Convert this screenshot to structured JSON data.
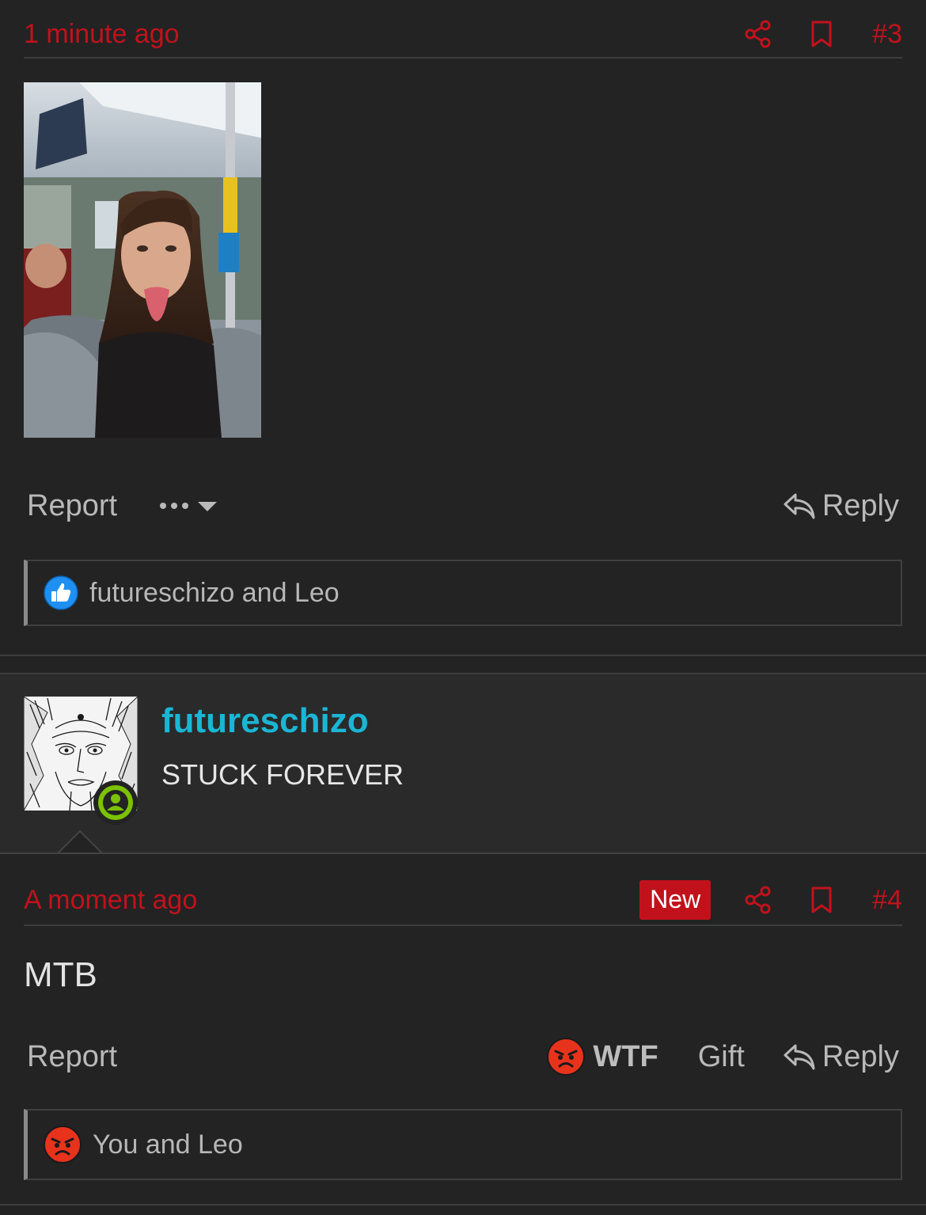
{
  "post3": {
    "time": "1 minute ago",
    "number": "#3",
    "image_alt": "Photo of a girl sticking out her tongue on a bus",
    "actions": {
      "report": "Report",
      "reply": "Reply"
    },
    "reactions_text": "futureschizo and Leo"
  },
  "author4": {
    "username": "futureschizo",
    "user_title": "STUCK FOREVER",
    "online": true
  },
  "post4": {
    "time": "A moment ago",
    "badge": "New",
    "number": "#4",
    "body": "MTB",
    "actions": {
      "report": "Report",
      "wtf": "WTF",
      "gift": "Gift",
      "reply": "Reply"
    },
    "reactions_text": "You and Leo"
  },
  "colors": {
    "accent_red": "#c1121c",
    "username_cyan": "#1ab6d4",
    "online_green": "#7bc200",
    "like_blue": "#1f8ff2",
    "angry_red": "#e8331c"
  },
  "icons": {
    "share": "share-icon",
    "bookmark": "bookmark-icon",
    "reply": "reply-arrow-icon",
    "like": "like-reaction-icon",
    "angry": "angry-reaction-icon",
    "online": "online-user-icon",
    "more": "more-dots-icon"
  }
}
